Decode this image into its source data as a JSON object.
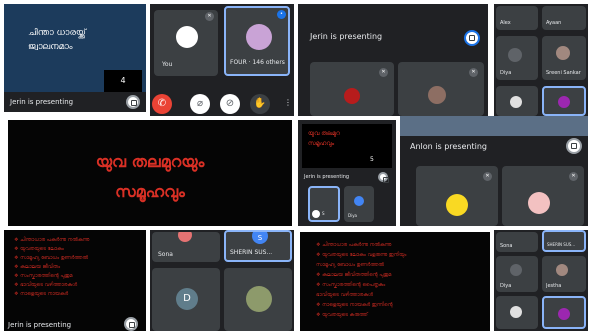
{
  "p1": {
    "slide_text_1": "ചിന്താ ധാരയ്ക്ക്",
    "slide_text_2": "ജ്വാലനമാം",
    "page_number": "4",
    "presenting": "Jerin is presenting"
  },
  "p2": {
    "you_label": "You",
    "four_label": "FOUR · 146 others"
  },
  "p3": {
    "presenting": "Jerin is presenting"
  },
  "p4": {
    "name1": "Alex",
    "name2": "Ayaan",
    "name3": "Diya",
    "name4": "Sreeni Sankar"
  },
  "p5": {
    "line1": "യുവ തലമുറയും",
    "line2": "സമൂഹവും"
  },
  "p6": {
    "slide_line1": "യുവ തലമുറ",
    "slide_line2": "സമൂഹവും",
    "page_number": "5",
    "presenting": "Jerin is presenting",
    "t1": "S",
    "t2": "Diya"
  },
  "p7": {
    "presenting": "Anlon is presenting"
  },
  "p8": {
    "presenting": "Jerin is presenting",
    "bullets": [
      "❖ ചിന്താധാര പകർന്നു നൽകുന്നു",
      "❖ യുവതയുടെ ലോകം",
      "❖ സാമൂഹ്യ ബോധം ഉണർത്തൽ",
      "❖ കലാലയ ജീവിതം",
      "❖ സംസ്കാരത്തിന്റെ പുതുമ",
      "❖ ഭാവിയുടെ വഴിത്താരകൾ",
      "❖ നാളെയുടെ നായകർ"
    ]
  },
  "p9": {
    "name1": "Sona",
    "name2": "SHERIN SUS...",
    "d_letter": "D",
    "s_letter": "S"
  },
  "p10": {
    "bullets": [
      "❖ ചിന്താധാര പകർന്നു നൽകുന്നു",
      "❖ യുവതയുടെ ലോകം വളരുന്നു ഇനിയും",
      "  സാമൂഹ്യ ബോധം ഉണർത്തൽ",
      "❖ കലാലയ ജീവിതത്തിന്റെ പുതുമ",
      "❖ സംസ്കാരത്തിന്റെ പൈതൃകം",
      "  ഭാവിയുടെ വഴിത്താരകൾ",
      "❖ നാളെയുടെ നായകർ ഇന്നിന്റെ",
      "❖ യുവതയുടെ കരുത്ത്"
    ]
  },
  "p11": {
    "name1": "Sona",
    "name2": "SHERIN SUS...",
    "name3": "Diya",
    "name4": "Jestha"
  },
  "colors": {
    "meet_bg": "#202124",
    "tile": "#3c4043",
    "slide_blue": "#1c3b5c",
    "slide_red": "#d93025",
    "end_call": "#ea4335",
    "accent": "#8ab4f8"
  }
}
